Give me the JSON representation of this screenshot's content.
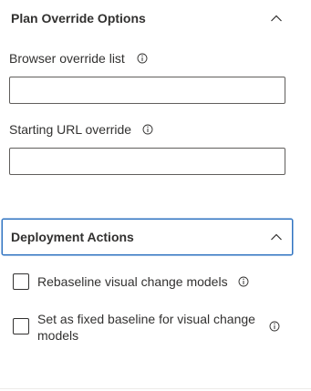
{
  "plan_section": {
    "title": "Plan Override Options",
    "collapse_icon": "chevron-up-icon",
    "fields": [
      {
        "label": "Browser override list",
        "value": "",
        "info_icon": "info-icon"
      },
      {
        "label": "Starting URL override",
        "value": "",
        "info_icon": "info-icon"
      }
    ]
  },
  "deployment_section": {
    "title": "Deployment Actions",
    "collapse_icon": "chevron-up-icon",
    "checkboxes": [
      {
        "label": "Rebaseline visual change models",
        "checked": false,
        "info_icon": "info-icon"
      },
      {
        "label": "Set as fixed baseline for visual change models",
        "checked": false,
        "info_icon": "info-icon"
      }
    ]
  },
  "colors": {
    "focus_border": "#2f73c1",
    "text": "#323130",
    "input_border": "#605e5c"
  }
}
